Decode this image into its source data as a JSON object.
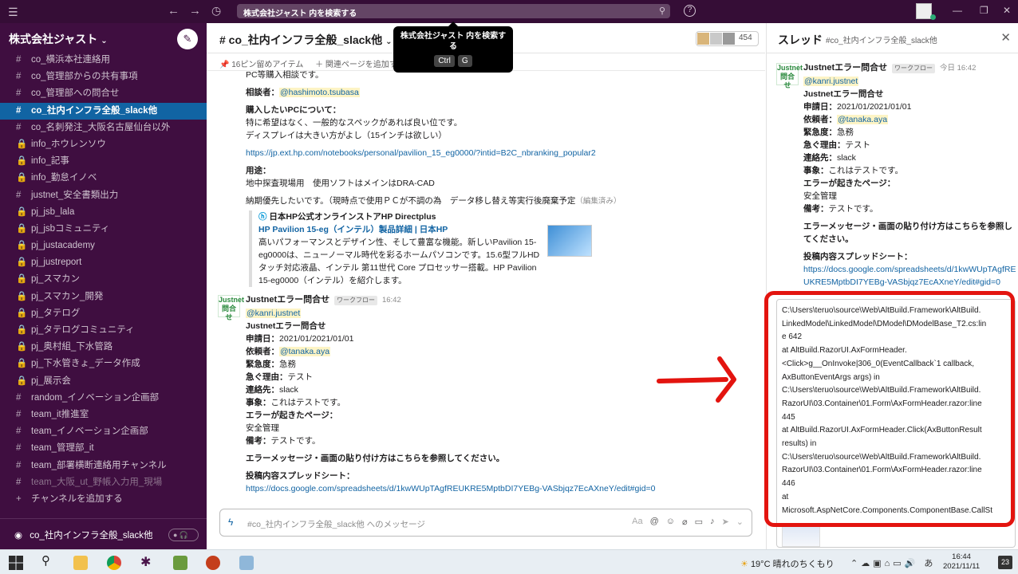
{
  "titlebar": {
    "search_text": "株式会社ジャスト 内を検索する",
    "help": "?"
  },
  "tooltip": {
    "text": "株式会社ジャスト 内を検索する",
    "key1": "Ctrl",
    "key2": "G"
  },
  "sidebar": {
    "workspace": "株式会社ジャスト",
    "channels": [
      {
        "prefix": "#",
        "label": "co_横浜本社連絡用"
      },
      {
        "prefix": "#",
        "label": "co_管理部からの共有事項"
      },
      {
        "prefix": "#",
        "label": "co_管理部への問合せ"
      },
      {
        "prefix": "#",
        "label": "co_社内インフラ全般_slack他"
      },
      {
        "prefix": "#",
        "label": "co_名刺発注_大阪名古屋仙台以外"
      },
      {
        "prefix": "🔒",
        "label": "info_ホウレンソウ"
      },
      {
        "prefix": "🔒",
        "label": "info_記事"
      },
      {
        "prefix": "🔒",
        "label": "info_勤怠イノベ"
      },
      {
        "prefix": "#",
        "label": "justnet_安全書類出力"
      },
      {
        "prefix": "🔒",
        "label": "pj_jsb_lala"
      },
      {
        "prefix": "🔒",
        "label": "pj_jsbコミュニティ"
      },
      {
        "prefix": "🔒",
        "label": "pj_justacademy"
      },
      {
        "prefix": "🔒",
        "label": "pj_justreport"
      },
      {
        "prefix": "🔒",
        "label": "pj_スマカン"
      },
      {
        "prefix": "🔒",
        "label": "pj_スマカン_開発"
      },
      {
        "prefix": "🔒",
        "label": "pj_タテログ"
      },
      {
        "prefix": "🔒",
        "label": "pj_タテログコミュニティ"
      },
      {
        "prefix": "🔒",
        "label": "pj_奥村組_下水管路"
      },
      {
        "prefix": "🔒",
        "label": "pj_下水管きょ_データ作成"
      },
      {
        "prefix": "🔒",
        "label": "pj_展示会"
      },
      {
        "prefix": "#",
        "label": "random_イノベーション企画部"
      },
      {
        "prefix": "#",
        "label": "team_it推進室"
      },
      {
        "prefix": "#",
        "label": "team_イノベーション企画部"
      },
      {
        "prefix": "#",
        "label": "team_管理部_it"
      },
      {
        "prefix": "#",
        "label": "team_部署横断連絡用チャンネル"
      },
      {
        "prefix": "#",
        "label": "team_大阪_ut_野帳入力用_現場"
      },
      {
        "prefix": "+",
        "label": "チャンネルを追加する"
      }
    ],
    "huddle_channel": "co_社内インフラ全般_slack他"
  },
  "main": {
    "channel_title": "# co_社内インフラ全般_slack他",
    "member_count": "454",
    "pinned": "16ピン留めアイテム",
    "add_page": "関連ページを追加す",
    "today_label": "今日",
    "message1": {
      "line_top": "PC等購入相談です。",
      "consultant_label": "相談者：",
      "consultant": "@hashimoto.tsubasa",
      "pc_heading": "購入したいPCについて：",
      "pc_line1": "特に希望はなく、一般的なスペックがあれば良い位です。",
      "pc_line2": "ディスプレイは大きい方がよし（15インチは欲しい）",
      "hp_url": "https://jp.ext.hp.com/notebooks/personal/pavilion_15_eg0000/?intid=B2C_nbranking_popular2",
      "use_label": "用途：",
      "use_text": "地中探査現場用　使用ソフトはメインはDRA-CAD",
      "delivery_text": "納期優先したいです。（現時点で使用ＰＣが不調の為　データ移し替え等実行後廃棄予定",
      "edited": "（編集済み）",
      "unfurl_site": "日本HP公式オンラインストアHP Directplus",
      "unfurl_title": "HP Pavilion 15-eg（インテル）製品詳細 | 日本HP",
      "unfurl_desc": "高いパフォーマンスとデザイン性、そして豊富な機能。新しいPavilion 15-eg0000は、ニューノーマル時代を彩るホームパソコンです。15.6型フルHDタッチ対応液晶、インテル 第11世代 Core プロセッサー搭載。HP Pavilion 15-eg0000（インテル）を紹介します。"
    },
    "message2": {
      "avatar": "Justnet 問合せ",
      "sender": "Justnetエラー問合せ",
      "badge": "ワークフロー",
      "time": "16:42",
      "mention": "@kanri.justnet",
      "title": "Justnetエラー問合せ",
      "date_label": "申請日：",
      "date": "2021/01/2021/01/01",
      "requester_label": "依頼者：",
      "requester": "@tanaka.aya",
      "urgency_label": "緊急度：",
      "urgency": "急務",
      "reason_label": "急ぐ理由：",
      "reason": "テスト",
      "contact_label": "連絡先：",
      "contact": "slack",
      "matter_label": "事象：",
      "matter": "これはテストです。",
      "page_label": "エラーが起きたページ：",
      "page": "安全管理",
      "note_label": "備考：",
      "note": "テストです。",
      "paste_heading": "エラーメッセージ・画面の貼り付け方はこちらを参照してください。",
      "sheet_label": "投稿内容スプレッドシート：",
      "sheet_url": "https://docs.google.com/spreadsheets/d/1kwWUpTAgfREUKRE5MptbDI7YEBg-VASbjqz7EcAXneY/edit#gid=0"
    },
    "composer_placeholder": "#co_社内インフラ全般_slack他 へのメッセージ"
  },
  "thread": {
    "title": "スレッド",
    "subtitle": "#co_社内インフラ全般_slack他",
    "sender": "Justnetエラー問合せ",
    "badge": "ワークフロー",
    "time": "今日 16:42",
    "sheet_url_l1": "https://docs.google.com/spreadsheets/d/1kwWUpTAgfRE",
    "sheet_url_l2": "UKRE5MptbDI7YEBg-VASbjqz7EcAXneY/edit#gid=0",
    "code_lines": [
      "C:\\Users\\teruo\\source\\Web\\AltBuild.Framework\\AltBuild.",
      "LinkedModel\\LinkedModel\\DModel\\DModelBase_T2.cs:lin",
      "e 642",
      "   at AltBuild.RazorUI.AxFormHeader.",
      "<Click>g__OnInvoke|306_0(EventCallback`1 callback,",
      "AxButtonEventArgs args) in",
      "C:\\Users\\teruo\\source\\Web\\AltBuild.Framework\\AltBuild.",
      "RazorUI\\03.Container\\01.Form\\AxFormHeader.razor:line",
      "445",
      "   at AltBuild.RazorUI.AxFormHeader.Click(AxButtonResult",
      "results) in",
      "C:\\Users\\teruo\\source\\Web\\AltBuild.Framework\\AltBuild.",
      "RazorUI\\03.Container\\01.Form\\AxFormHeader.razor:line",
      "446",
      "   at",
      "Microsoft.AspNetCore.Components.ComponentBase.CallSt"
    ]
  },
  "taskbar": {
    "weather": "19°C 晴れのちくもり",
    "ime": "あ",
    "time": "16:44",
    "date": "2021/11/11",
    "notifications": "23"
  },
  "colors": {
    "sidebar_bg": "#3f0e40",
    "active_channel": "#1164a3",
    "link": "#1264a3",
    "annotation_red": "#e3140f"
  }
}
